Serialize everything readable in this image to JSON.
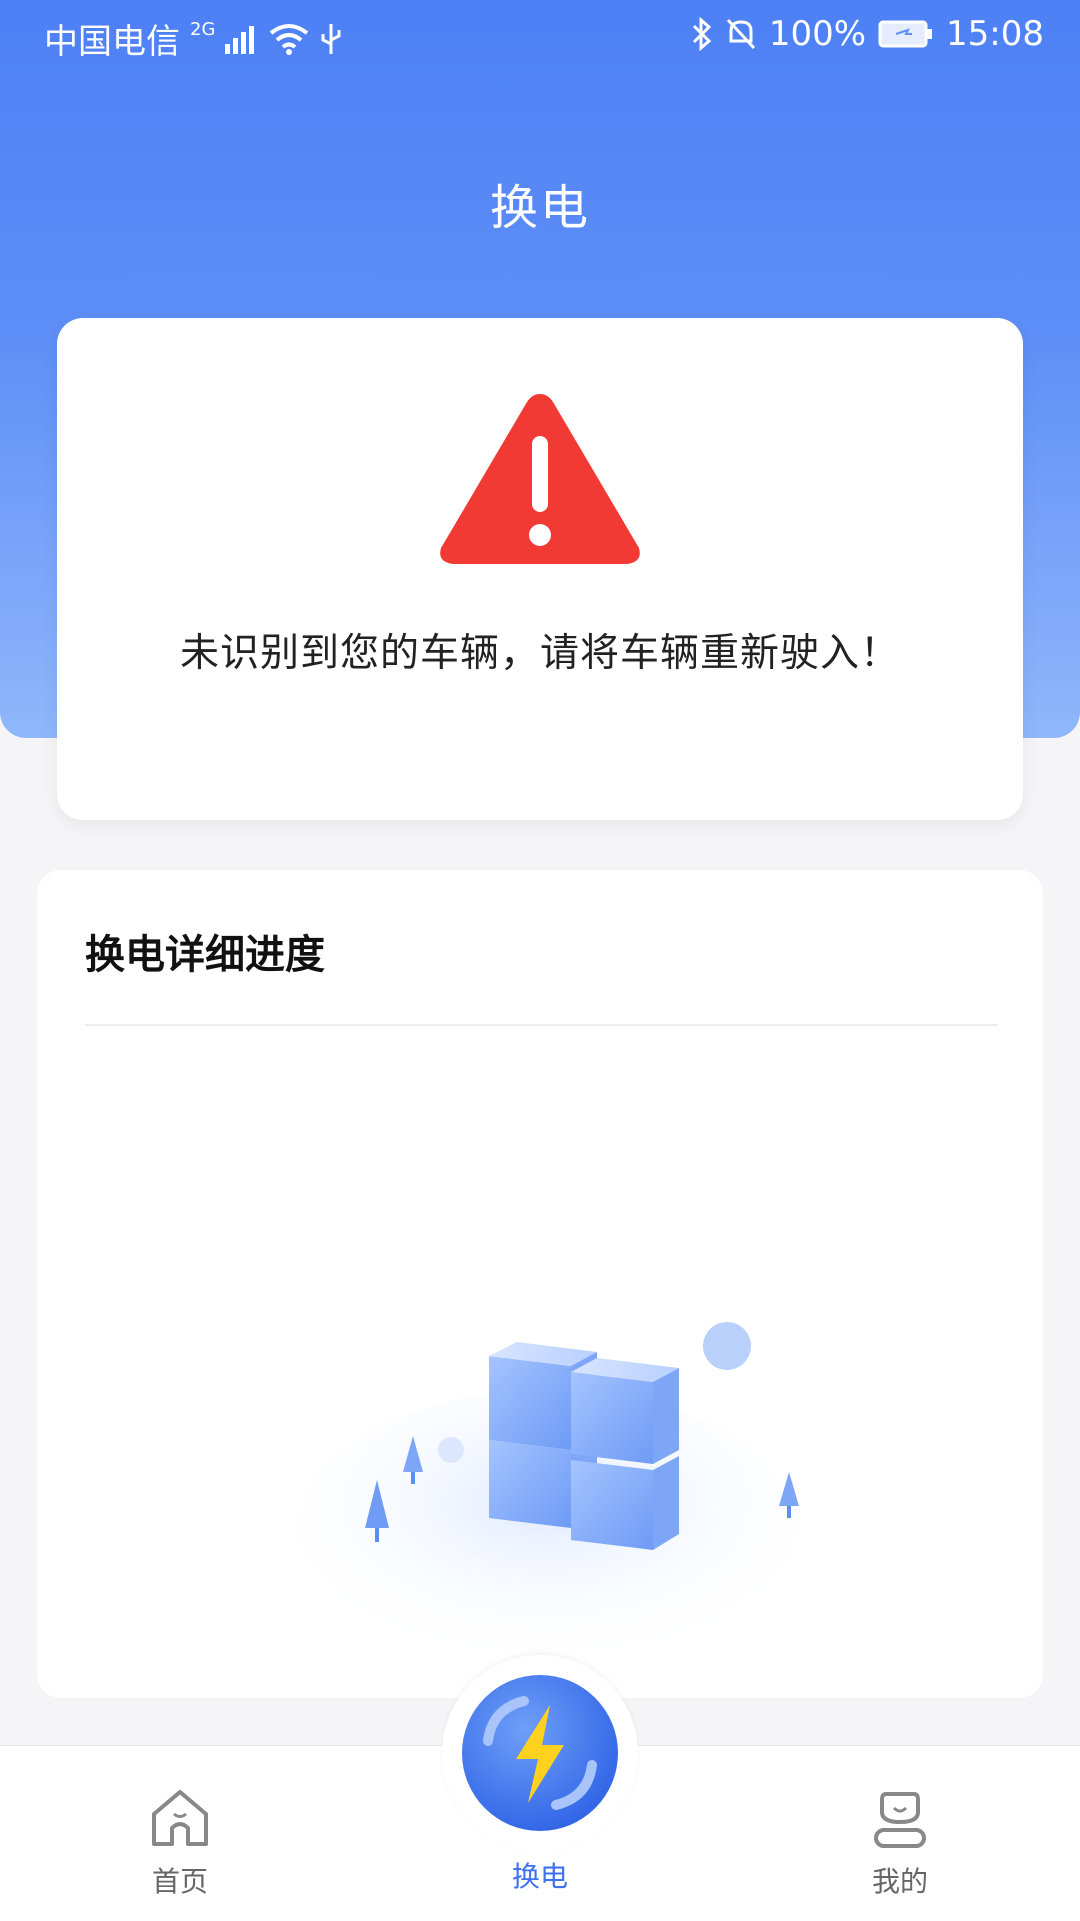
{
  "status_bar": {
    "carrier": "中国电信",
    "network": "2G",
    "battery": "100%",
    "time": "15:08"
  },
  "header": {
    "title": "换电"
  },
  "alert": {
    "icon": "warning-triangle-icon",
    "message": "未识别到您的车辆，请将车辆重新驶入！"
  },
  "progress": {
    "title": "换电详细进度",
    "illustration": "empty-state-cubes"
  },
  "tab_bar": {
    "tabs": [
      {
        "label": "首页",
        "icon": "home-icon"
      },
      {
        "label": "换电",
        "icon": "battery-swap-icon",
        "active": true
      },
      {
        "label": "我的",
        "icon": "profile-icon"
      }
    ]
  },
  "colors": {
    "primary": "#4d80f5",
    "warning": "#f23a35",
    "active_tab": "#3e72ee"
  }
}
